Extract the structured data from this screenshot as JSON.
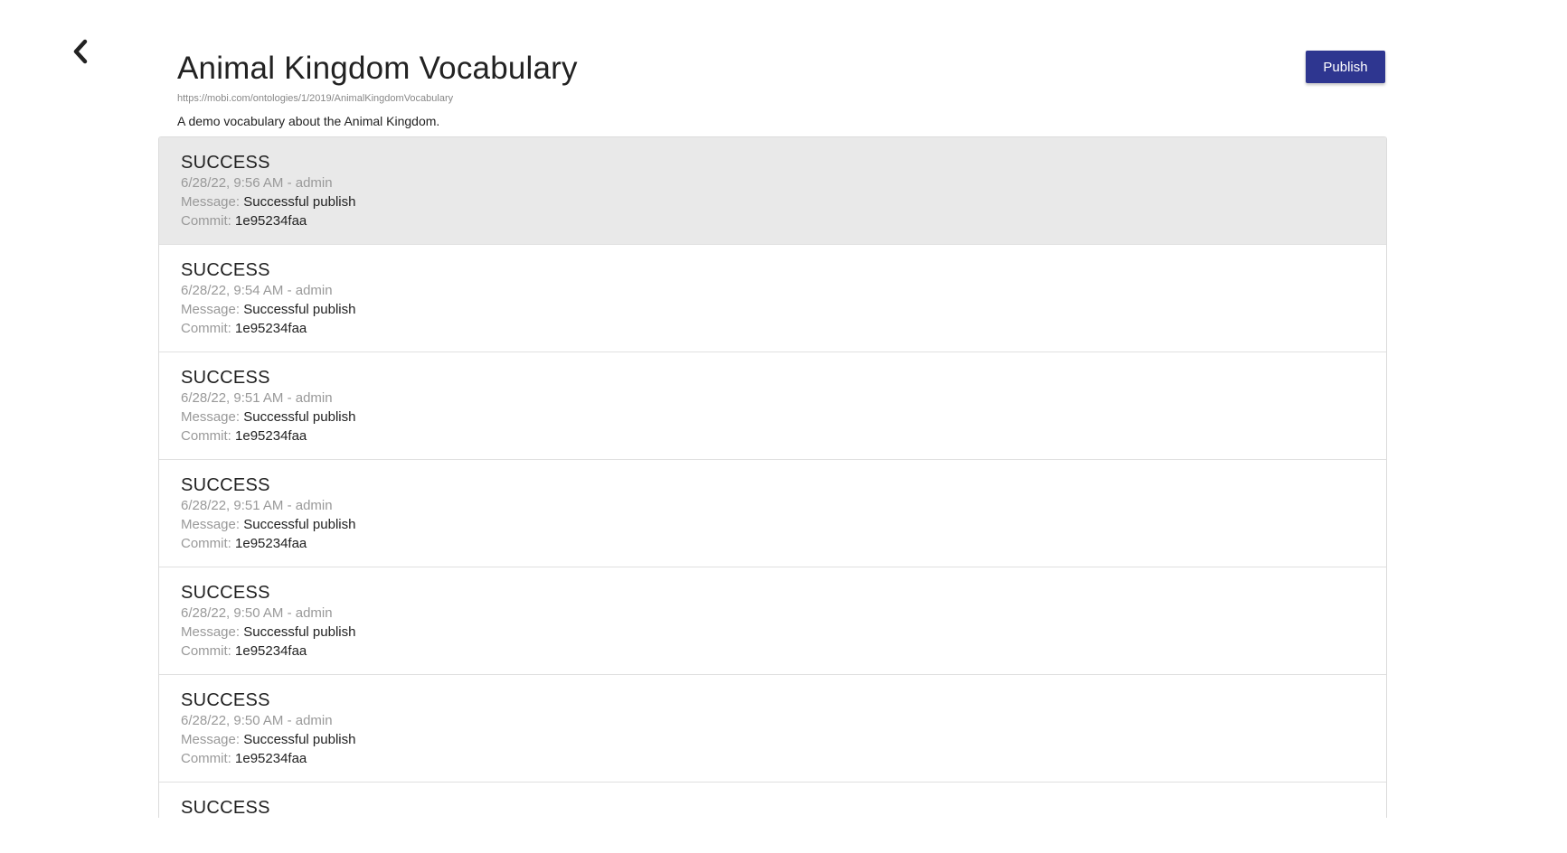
{
  "header": {
    "back_icon": "chevron-left-icon",
    "title": "Animal Kingdom Vocabulary",
    "iri": "https://mobi.com/ontologies/1/2019/AnimalKingdomVocabulary",
    "description": "A demo vocabulary about the Animal Kingdom.",
    "publish_label": "Publish"
  },
  "colors": {
    "accent": "#2e3690",
    "selected_row": "#e9e9e9",
    "muted_text": "#999999"
  },
  "history": {
    "message_label": "Message:",
    "commit_label": "Commit:",
    "items": [
      {
        "status": "SUCCESS",
        "meta": "6/28/22, 9:56 AM - admin",
        "message": "Successful publish",
        "commit": "1e95234faa",
        "selected": true
      },
      {
        "status": "SUCCESS",
        "meta": "6/28/22, 9:54 AM - admin",
        "message": "Successful publish",
        "commit": "1e95234faa",
        "selected": false
      },
      {
        "status": "SUCCESS",
        "meta": "6/28/22, 9:51 AM - admin",
        "message": "Successful publish",
        "commit": "1e95234faa",
        "selected": false
      },
      {
        "status": "SUCCESS",
        "meta": "6/28/22, 9:51 AM - admin",
        "message": "Successful publish",
        "commit": "1e95234faa",
        "selected": false
      },
      {
        "status": "SUCCESS",
        "meta": "6/28/22, 9:50 AM - admin",
        "message": "Successful publish",
        "commit": "1e95234faa",
        "selected": false
      },
      {
        "status": "SUCCESS",
        "meta": "6/28/22, 9:50 AM - admin",
        "message": "Successful publish",
        "commit": "1e95234faa",
        "selected": false
      },
      {
        "status": "SUCCESS",
        "meta": "",
        "message": "",
        "commit": "",
        "selected": false
      }
    ]
  }
}
